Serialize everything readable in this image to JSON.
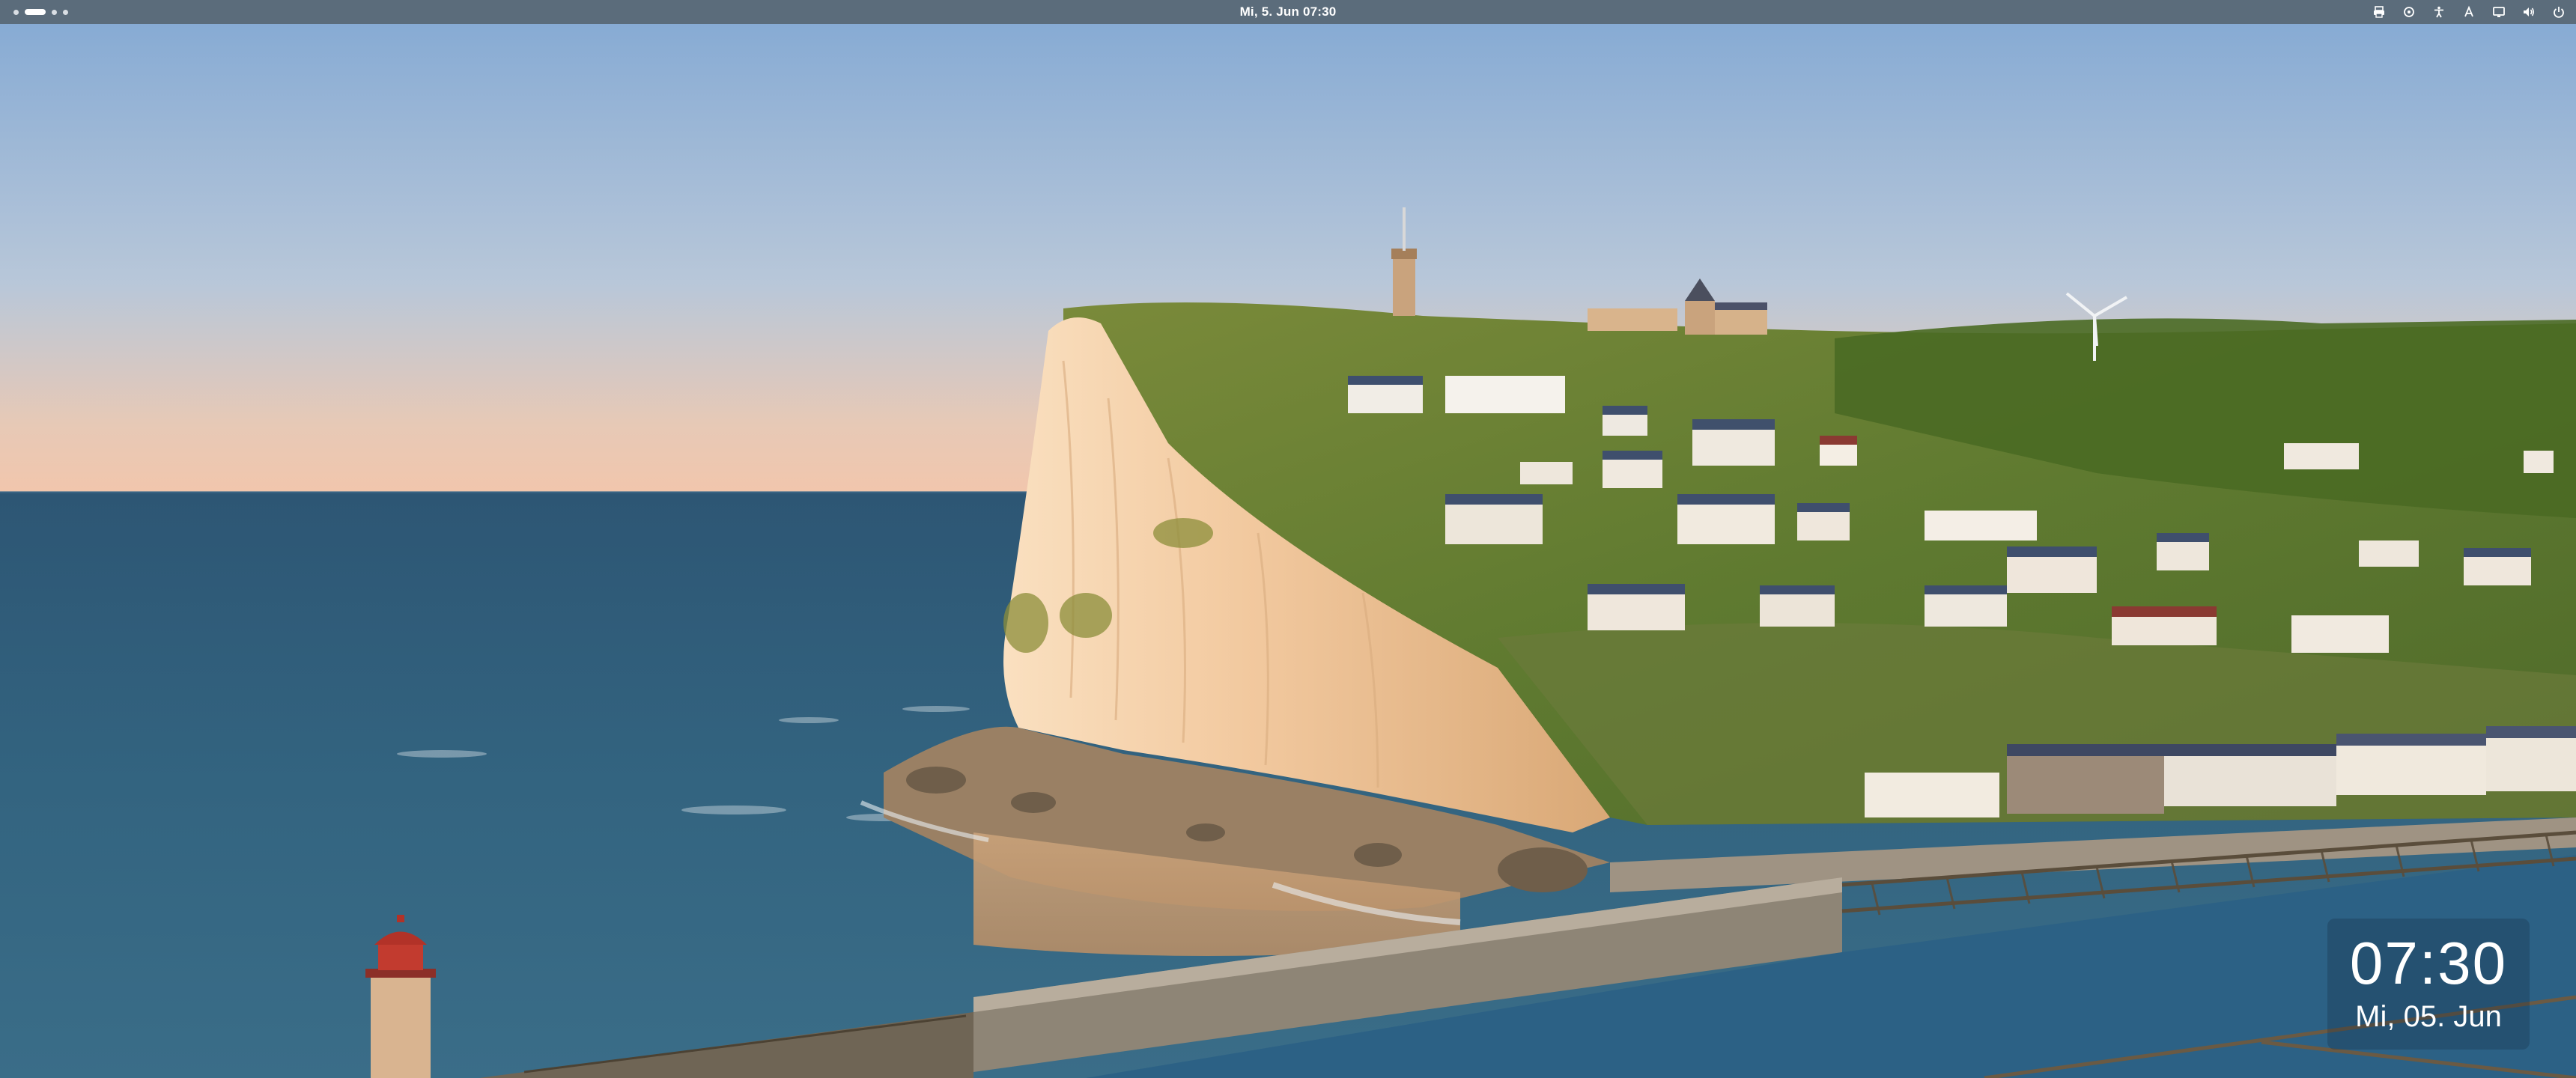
{
  "topbar": {
    "datetime": "Mi, 5. Jun  07:30",
    "workspaces": [
      "dot",
      "active-pill",
      "dot",
      "dot"
    ],
    "tray_icons": [
      "printer-icon",
      "network-icon",
      "accessibility-icon",
      "text-input-icon",
      "display-icon",
      "sound-icon",
      "power-icon"
    ]
  },
  "lock_clock": {
    "time": "07:30",
    "date": "Mi, 05. Jun"
  },
  "colors": {
    "topbar": "#5b6c7b",
    "sky_top": "#8ab0d6",
    "sky_horizon": "#f0c7ac",
    "sea": "#2f5d7a",
    "cliff": "#f1c79a"
  }
}
